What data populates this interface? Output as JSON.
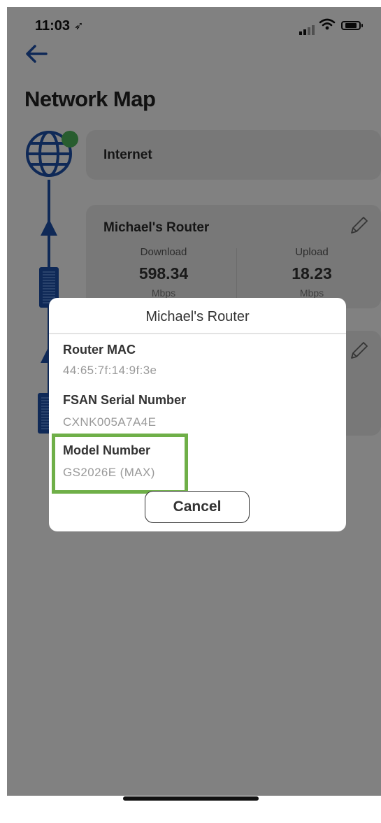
{
  "status_bar": {
    "time": "11:03",
    "location_glyph": "➶"
  },
  "header": {
    "title": "Network Map"
  },
  "network": {
    "internet_card": {
      "title": "Internet"
    },
    "router_card": {
      "title": "Michael's Router",
      "download": {
        "label": "Download",
        "value": "598.34",
        "unit": "Mbps"
      },
      "upload": {
        "label": "Upload",
        "value": "18.23",
        "unit": "Mbps"
      }
    }
  },
  "dialog": {
    "title": "Michael's Router",
    "fields": [
      {
        "label": "Router MAC",
        "value": "44:65:7f:14:9f:3e"
      },
      {
        "label": "FSAN Serial Number",
        "value": "CXNK005A7A4E"
      },
      {
        "label": "Model Number",
        "value": "GS2026E (MAX)"
      }
    ],
    "cancel_label": "Cancel"
  },
  "colors": {
    "accent": "#1d4fa8",
    "online": "#4db35a",
    "highlight": "#6faf48"
  },
  "icons": [
    "back-arrow-icon",
    "globe-icon",
    "online-status-dot",
    "pencil-icon",
    "router-icon",
    "signal-icon",
    "wifi-icon",
    "battery-icon"
  ]
}
